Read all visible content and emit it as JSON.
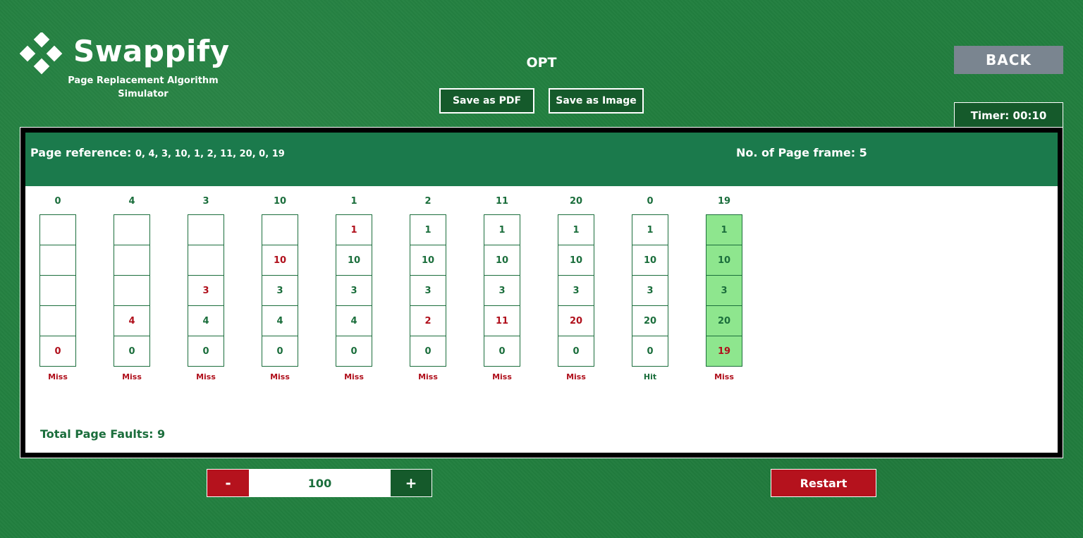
{
  "logo": {
    "title": "Swappify",
    "subtitle": "Page Replacement Algorithm Simulator",
    "icon": "diamond-cluster-icon"
  },
  "algorithm": "OPT",
  "actions": {
    "save_pdf": "Save as PDF",
    "save_image": "Save as Image",
    "back": "BACK"
  },
  "timer": "Timer: 00:10",
  "page_reference": {
    "label": "Page reference:",
    "value": "0, 4, 3, 10, 1, 2, 11, 20, 0, 19"
  },
  "frames": {
    "label": "No. of Page frame:",
    "value": "5"
  },
  "steps": [
    {
      "ref": "0",
      "cells": [
        "",
        "",
        "",
        "",
        "0"
      ],
      "new_index": 4,
      "result": "Miss",
      "highlight": false
    },
    {
      "ref": "4",
      "cells": [
        "",
        "",
        "",
        "4",
        "0"
      ],
      "new_index": 3,
      "result": "Miss",
      "highlight": false
    },
    {
      "ref": "3",
      "cells": [
        "",
        "",
        "3",
        "4",
        "0"
      ],
      "new_index": 2,
      "result": "Miss",
      "highlight": false
    },
    {
      "ref": "10",
      "cells": [
        "",
        "10",
        "3",
        "4",
        "0"
      ],
      "new_index": 1,
      "result": "Miss",
      "highlight": false
    },
    {
      "ref": "1",
      "cells": [
        "1",
        "10",
        "3",
        "4",
        "0"
      ],
      "new_index": 0,
      "result": "Miss",
      "highlight": false
    },
    {
      "ref": "2",
      "cells": [
        "1",
        "10",
        "3",
        "2",
        "0"
      ],
      "new_index": 3,
      "result": "Miss",
      "highlight": false
    },
    {
      "ref": "11",
      "cells": [
        "1",
        "10",
        "3",
        "11",
        "0"
      ],
      "new_index": 3,
      "result": "Miss",
      "highlight": false
    },
    {
      "ref": "20",
      "cells": [
        "1",
        "10",
        "3",
        "20",
        "0"
      ],
      "new_index": 3,
      "result": "Miss",
      "highlight": false
    },
    {
      "ref": "0",
      "cells": [
        "1",
        "10",
        "3",
        "20",
        "0"
      ],
      "new_index": -1,
      "result": "Hit",
      "highlight": false
    },
    {
      "ref": "19",
      "cells": [
        "1",
        "10",
        "3",
        "20",
        "19"
      ],
      "new_index": 4,
      "result": "Miss",
      "highlight": true
    }
  ],
  "total_faults": "Total Page Faults: 9",
  "speed": {
    "minus": "-",
    "value": "100",
    "plus": "+"
  },
  "restart": "Restart",
  "colors": {
    "background": "#22803f",
    "header": "#1b7a4c",
    "text_green": "#1b6e3c",
    "miss_red": "#b0101c",
    "highlight": "#8ee68e",
    "back_gray": "#7a8590"
  }
}
